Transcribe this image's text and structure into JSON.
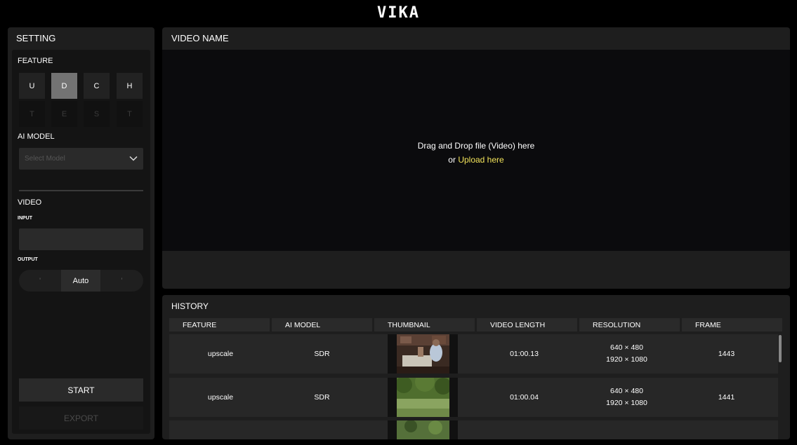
{
  "app": {
    "logo": "VIKA"
  },
  "sidebar": {
    "title": "SETTING",
    "feature_label": "FEATURE",
    "features": [
      {
        "label": "U",
        "state": "normal"
      },
      {
        "label": "D",
        "state": "active"
      },
      {
        "label": "C",
        "state": "normal"
      },
      {
        "label": "H",
        "state": "normal"
      },
      {
        "label": "T",
        "state": "disabled"
      },
      {
        "label": "E",
        "state": "disabled"
      },
      {
        "label": "S",
        "state": "disabled"
      },
      {
        "label": "T",
        "state": "disabled"
      }
    ],
    "ai_model_label": "AI MODEL",
    "model_placeholder": "Select Model",
    "video_label": "VIDEO",
    "input_label": "INPUT",
    "input_value": "",
    "output_label": "OUTPUT",
    "output_options": [
      "'",
      "Auto",
      "'"
    ],
    "output_selected": "Auto",
    "start_label": "START",
    "export_label": "EXPORT"
  },
  "video": {
    "title": "VIDEO NAME",
    "drop_text": "Drag and Drop file (Video) here",
    "or_text": "or ",
    "upload_link": "Upload here"
  },
  "history": {
    "title": "HISTORY",
    "columns": [
      "FEATURE",
      "AI MODEL",
      "THUMBNAIL",
      "VIDEO LENGTH",
      "RESOLUTION",
      "FRAME"
    ],
    "rows": [
      {
        "feature": "upscale",
        "ai_model": "SDR",
        "length": "01:00.13",
        "res_in": "640 × 480",
        "res_out": "1920 × 1080",
        "frame": "1443"
      },
      {
        "feature": "upscale",
        "ai_model": "SDR",
        "length": "01:00.04",
        "res_in": "640 × 480",
        "res_out": "1920 × 1080",
        "frame": "1441"
      }
    ]
  },
  "colors": {
    "accent_link": "#f2e35a",
    "active_feature": "#737373",
    "panel_bg": "#1e1e1e"
  }
}
